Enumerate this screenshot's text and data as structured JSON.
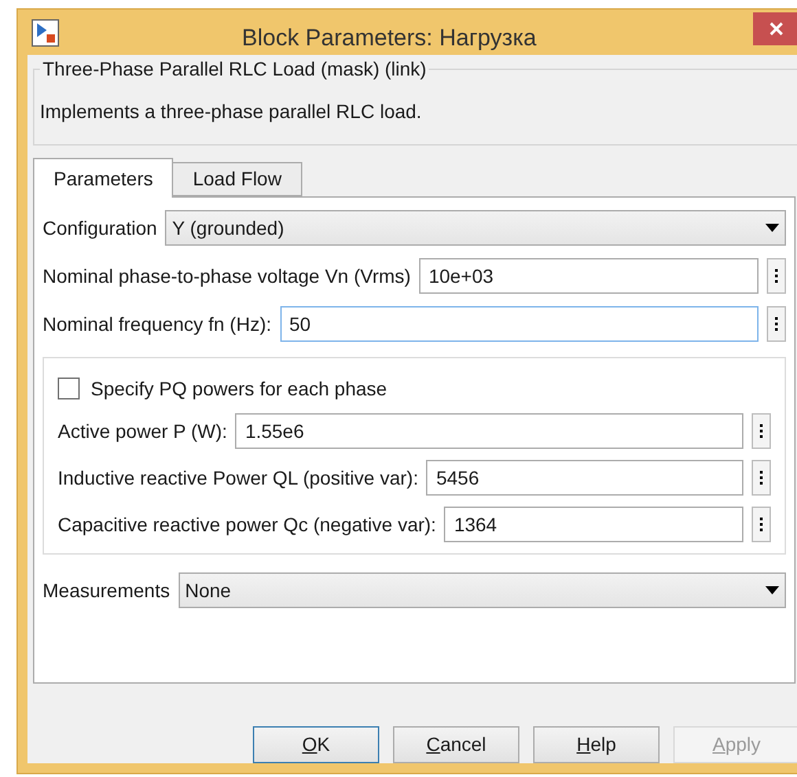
{
  "window": {
    "title": "Block Parameters: Нагрузка"
  },
  "mask": {
    "title": "Three-Phase Parallel RLC Load (mask) (link)",
    "description": "Implements a three-phase parallel RLC load."
  },
  "tabs": [
    {
      "label": "Parameters",
      "selected": true
    },
    {
      "label": "Load Flow",
      "selected": false
    }
  ],
  "configuration": {
    "label": "Configuration",
    "value": "Y (grounded)"
  },
  "top_fields": [
    {
      "label": "Nominal phase-to-phase voltage Vn (Vrms)",
      "value": "10e+03",
      "focused": false
    },
    {
      "label": "Nominal frequency fn (Hz):",
      "value": "50",
      "focused": true
    }
  ],
  "pq_checkbox": {
    "label": "Specify PQ powers for each phase",
    "checked": false
  },
  "power_fields": [
    {
      "label": "Active power P (W):",
      "value": "1.55e6"
    },
    {
      "label": "Inductive reactive Power QL (positive var):",
      "value": "5456"
    },
    {
      "label": "Capacitive reactive power Qc (negative var):",
      "value": "1364"
    }
  ],
  "measurements": {
    "label": "Measurements",
    "value": "None"
  },
  "buttons": [
    {
      "mnemonic": "O",
      "rest": "K",
      "default": true,
      "disabled": false
    },
    {
      "mnemonic": "C",
      "rest": "ancel",
      "default": false,
      "disabled": false
    },
    {
      "mnemonic": "H",
      "rest": "elp",
      "default": false,
      "disabled": false
    },
    {
      "mnemonic": "A",
      "rest": "pply",
      "default": false,
      "disabled": true
    }
  ]
}
